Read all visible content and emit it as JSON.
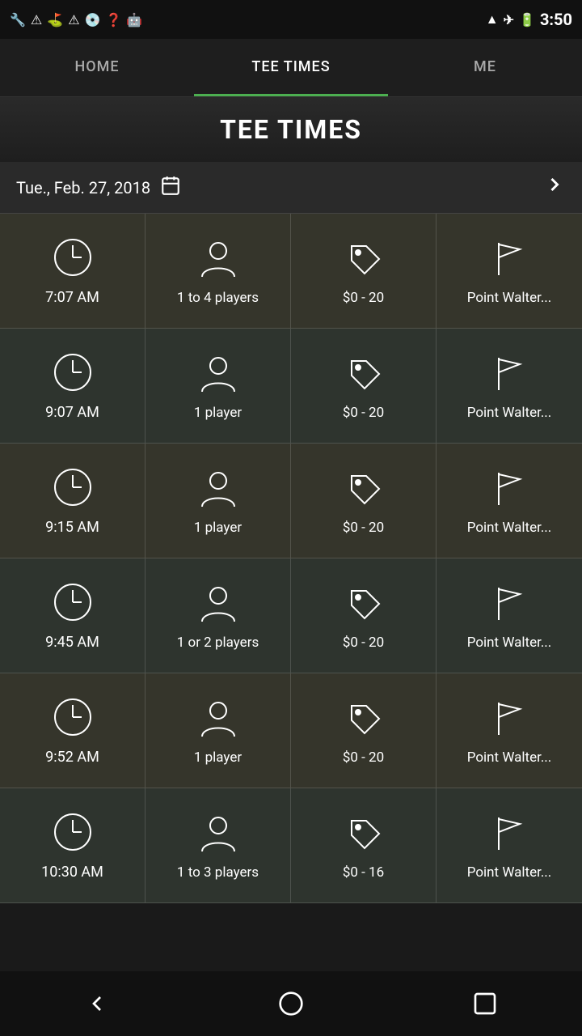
{
  "statusBar": {
    "time": "3:50",
    "iconsLeft": [
      "wrench",
      "warning",
      "golf",
      "warning2",
      "disc",
      "question",
      "android"
    ],
    "iconsRight": [
      "wifi",
      "airplane",
      "battery"
    ]
  },
  "nav": {
    "tabs": [
      {
        "id": "home",
        "label": "HOME",
        "active": false
      },
      {
        "id": "tee-times",
        "label": "TEE TIMES",
        "active": true
      },
      {
        "id": "me",
        "label": "ME",
        "active": false
      }
    ]
  },
  "pageTitle": "TEE TIMES",
  "dateRow": {
    "date": "Tue., Feb. 27, 2018",
    "calIcon": "📅"
  },
  "teeRows": [
    {
      "time": "7:07 AM",
      "players": "1 to 4 players",
      "price": "$0 - 20",
      "course": "Point Walter..."
    },
    {
      "time": "9:07 AM",
      "players": "1 player",
      "price": "$0 - 20",
      "course": "Point Walter..."
    },
    {
      "time": "9:15 AM",
      "players": "1 player",
      "price": "$0 - 20",
      "course": "Point Walter..."
    },
    {
      "time": "9:45 AM",
      "players": "1 or 2 players",
      "price": "$0 - 20",
      "course": "Point Walter..."
    },
    {
      "time": "9:52 AM",
      "players": "1 player",
      "price": "$0 - 20",
      "course": "Point Walter..."
    },
    {
      "time": "10:30 AM",
      "players": "1 to 3 players",
      "price": "$0 - 16",
      "course": "Point Walter..."
    }
  ],
  "bottomNav": {
    "back": "◁",
    "home": "○",
    "recent": "□"
  }
}
